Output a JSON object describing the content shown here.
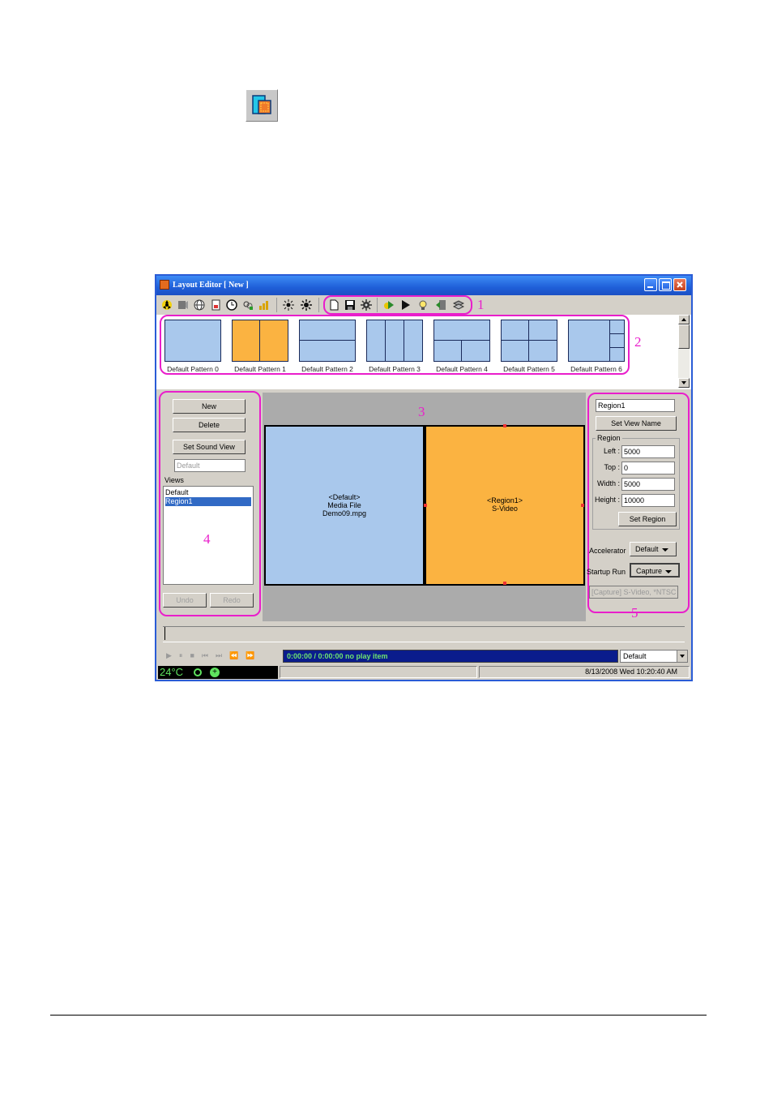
{
  "window": {
    "title": "Layout Editor [ New ]",
    "accent_color": "#2a5cd6"
  },
  "callouts": {
    "n1": "1",
    "n2": "2",
    "n3": "3",
    "n4": "4",
    "n5": "5",
    "color": "#e91ecb"
  },
  "toolbar": {
    "icons": [
      "radiation-icon",
      "film-icon",
      "globe-icon",
      "document-icon",
      "clock-icon",
      "link-icon",
      "chart-icon",
      "brightness-down-icon",
      "brightness-up-icon",
      "new-icon",
      "save-icon",
      "settings-gear-icon",
      "run-icon",
      "play-icon",
      "light-icon",
      "export-icon",
      "stack-icon"
    ]
  },
  "patterns": [
    {
      "label": "Default Pattern 0"
    },
    {
      "label": "Default Pattern 1"
    },
    {
      "label": "Default Pattern 2"
    },
    {
      "label": "Default Pattern 3"
    },
    {
      "label": "Default Pattern 4"
    },
    {
      "label": "Default Pattern 5"
    },
    {
      "label": "Default Pattern 6"
    }
  ],
  "left_panel": {
    "new_label": "New",
    "delete_label": "Delete",
    "set_sound_view_label": "Set Sound View",
    "sound_view_value": "Default",
    "views_label": "Views",
    "views": [
      "Default",
      "Region1"
    ],
    "selected_view": "Region1",
    "undo_label": "Undo",
    "redo_label": "Redo"
  },
  "canvas": {
    "default_region": {
      "line1": "<Default>",
      "line2": "Media File",
      "line3": "Demo09.mpg",
      "color": "#a9c8ec"
    },
    "region1": {
      "line1": "<Region1>",
      "line2": "S-Video",
      "color": "#fbb341"
    }
  },
  "right_panel": {
    "view_name": "Region1",
    "set_view_name_label": "Set View Name",
    "region_group_label": "Region",
    "left_label": "Left :",
    "left_value": "5000",
    "top_label": "Top :",
    "top_value": "0",
    "width_label": "Width :",
    "width_value": "5000",
    "height_label": "Height :",
    "height_value": "10000",
    "set_region_label": "Set Region",
    "accelerator_label": "Accelerator",
    "accelerator_value": "Default",
    "startup_run_label": "Startup Run",
    "startup_run_value": "Capture",
    "capture_info": "[Capture] S-Video, *NTSC"
  },
  "player": {
    "time_text": "0:00:00 / 0:00:00   no play item",
    "profile_value": "Default"
  },
  "statusbar": {
    "temperature": "24°C",
    "datetime": "8/13/2008 Wed 10:20:40 AM"
  }
}
